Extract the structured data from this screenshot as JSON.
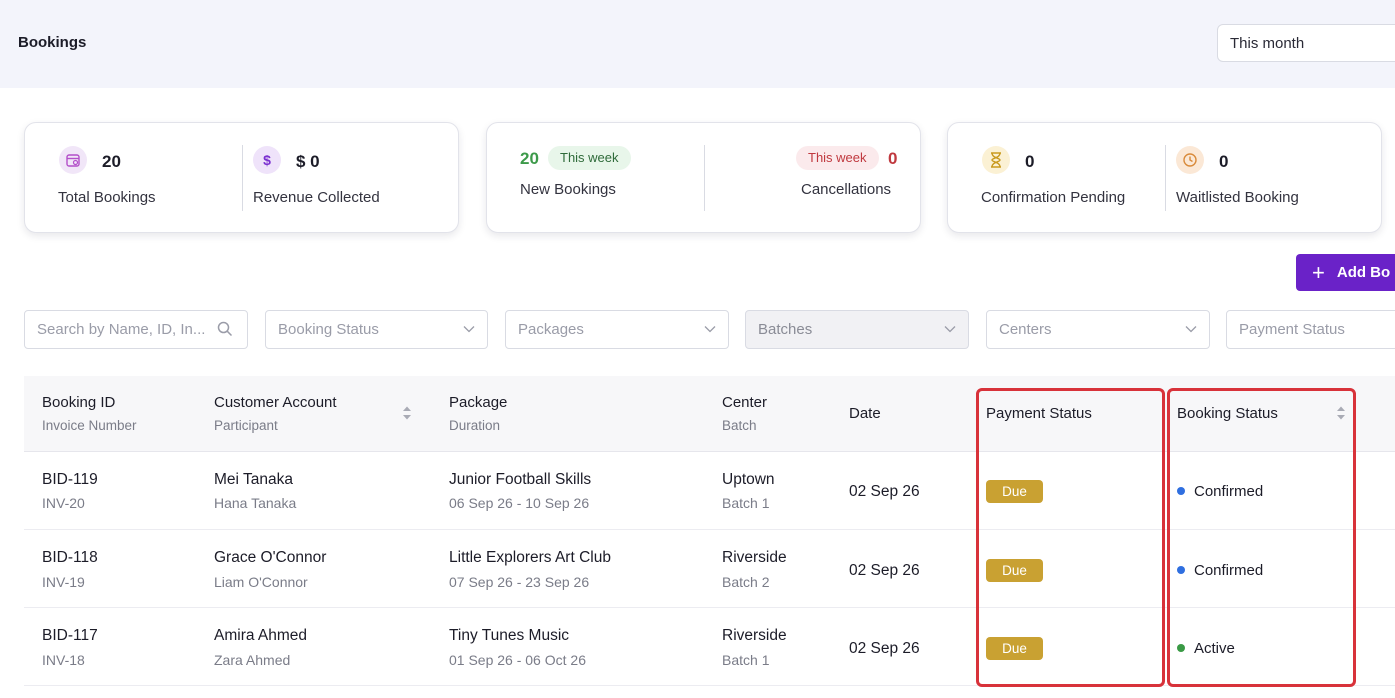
{
  "header": {
    "title": "Bookings",
    "period": "This month"
  },
  "stats": {
    "total_bookings": {
      "value": "20",
      "label": "Total Bookings"
    },
    "revenue": {
      "value": "$ 0",
      "label": "Revenue Collected"
    },
    "new_bookings": {
      "value": "20",
      "pill": "This week",
      "label": "New Bookings"
    },
    "cancellations": {
      "value": "0",
      "pill": "This week",
      "label": "Cancellations"
    },
    "confirmation_pending": {
      "value": "0",
      "label": "Confirmation Pending"
    },
    "waitlisted": {
      "value": "0",
      "label": "Waitlisted Booking"
    }
  },
  "actions": {
    "add_booking": "Add Bo"
  },
  "filters": {
    "search_placeholder": "Search by Name, ID, In...",
    "booking_status": "Booking Status",
    "packages": "Packages",
    "batches": "Batches",
    "centers": "Centers",
    "payment_status": "Payment Status"
  },
  "table": {
    "headers": {
      "booking_id": "Booking ID",
      "invoice_number": "Invoice Number",
      "customer_account": "Customer Account",
      "participant": "Participant",
      "package": "Package",
      "duration": "Duration",
      "center": "Center",
      "batch": "Batch",
      "date": "Date",
      "payment_status": "Payment Status",
      "booking_status": "Booking Status"
    },
    "rows": [
      {
        "booking_id": "BID-119",
        "invoice": "INV-20",
        "customer": "Mei Tanaka",
        "participant": "Hana Tanaka",
        "package": "Junior Football Skills",
        "duration": "06 Sep 26 - 10 Sep 26",
        "center": "Uptown",
        "batch": "Batch 1",
        "date": "02 Sep 26",
        "payment": "Due",
        "status": "Confirmed",
        "status_color": "#2f6fe0"
      },
      {
        "booking_id": "BID-118",
        "invoice": "INV-19",
        "customer": "Grace O'Connor",
        "participant": "Liam O'Connor",
        "package": "Little Explorers Art Club",
        "duration": "07 Sep 26 - 23 Sep 26",
        "center": "Riverside",
        "batch": "Batch 2",
        "date": "02 Sep 26",
        "payment": "Due",
        "status": "Confirmed",
        "status_color": "#2f6fe0"
      },
      {
        "booking_id": "BID-117",
        "invoice": "INV-18",
        "customer": "Amira Ahmed",
        "participant": "Zara Ahmed",
        "package": "Tiny Tunes Music",
        "duration": "01 Sep 26 - 06 Oct 26",
        "center": "Riverside",
        "batch": "Batch 1",
        "date": "02 Sep 26",
        "payment": "Due",
        "status": "Active",
        "status_color": "#3a9a45"
      }
    ]
  },
  "colors": {
    "accent": "#6a22c8",
    "due": "#c9a132",
    "highlight": "#d8323a",
    "this_week_green_bg": "#e8f6ea",
    "this_week_red_bg": "#fbeaec"
  }
}
